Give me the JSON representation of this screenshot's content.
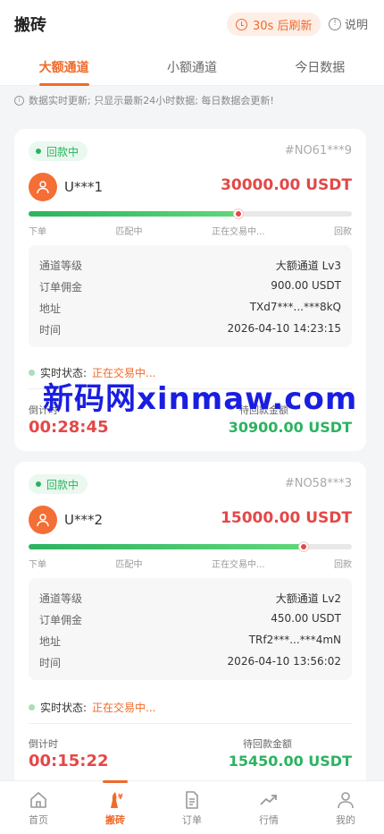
{
  "header": {
    "title": "搬砖",
    "refresh_label": "30s 后刷新",
    "help_label": "说明"
  },
  "tabs": [
    {
      "label": "大额通道",
      "active": true
    },
    {
      "label": "小额通道",
      "active": false
    },
    {
      "label": "今日数据",
      "active": false
    }
  ],
  "notice": "数据实时更新; 只显示最新24小时数据; 每日数据会更新!",
  "progress_steps": [
    "下单",
    "匹配中",
    "正在交易中...",
    "回款"
  ],
  "orders": [
    {
      "status": "回款中",
      "order_no": "#NO61***9",
      "user": "U***1",
      "amount": "30000.00 USDT",
      "progress": 0.65,
      "fields": [
        {
          "label": "通道等级",
          "value": "大额通道 Lv3"
        },
        {
          "label": "订单佣金",
          "value": "900.00 USDT"
        },
        {
          "label": "地址",
          "value": "TXd7***...***8kQ"
        },
        {
          "label": "时间",
          "value": "2026-04-10 14:23:15"
        }
      ],
      "realtime_label": "实时状态:",
      "realtime_value": "正在交易中...",
      "countdown_label": "倒计时",
      "countdown": "00:28:45",
      "pending_label": "待回款金额",
      "pending_amount": "30900.00 USDT"
    },
    {
      "status": "回款中",
      "order_no": "#NO58***3",
      "user": "U***2",
      "amount": "15000.00 USDT",
      "progress": 0.85,
      "fields": [
        {
          "label": "通道等级",
          "value": "大额通道 Lv2"
        },
        {
          "label": "订单佣金",
          "value": "450.00 USDT"
        },
        {
          "label": "地址",
          "value": "TRf2***...***4mN"
        },
        {
          "label": "时间",
          "value": "2026-04-10 13:56:02"
        }
      ],
      "realtime_label": "实时状态:",
      "realtime_value": "正在交易中...",
      "countdown_label": "倒计时",
      "countdown": "00:15:22",
      "pending_label": "待回款金额",
      "pending_amount": "15450.00 USDT"
    }
  ],
  "watermark": "新码网xinmaw.com",
  "tabbar": [
    {
      "label": "首页",
      "icon": "home-icon",
      "active": false
    },
    {
      "label": "搬砖",
      "icon": "brick-coin-icon",
      "active": true
    },
    {
      "label": "订单",
      "icon": "document-icon",
      "active": false
    },
    {
      "label": "行情",
      "icon": "trend-icon",
      "active": false
    },
    {
      "label": "我的",
      "icon": "user-icon",
      "active": false
    }
  ],
  "colors": {
    "accent": "#f06a2a",
    "red": "#e44848",
    "green": "#2bb360"
  }
}
